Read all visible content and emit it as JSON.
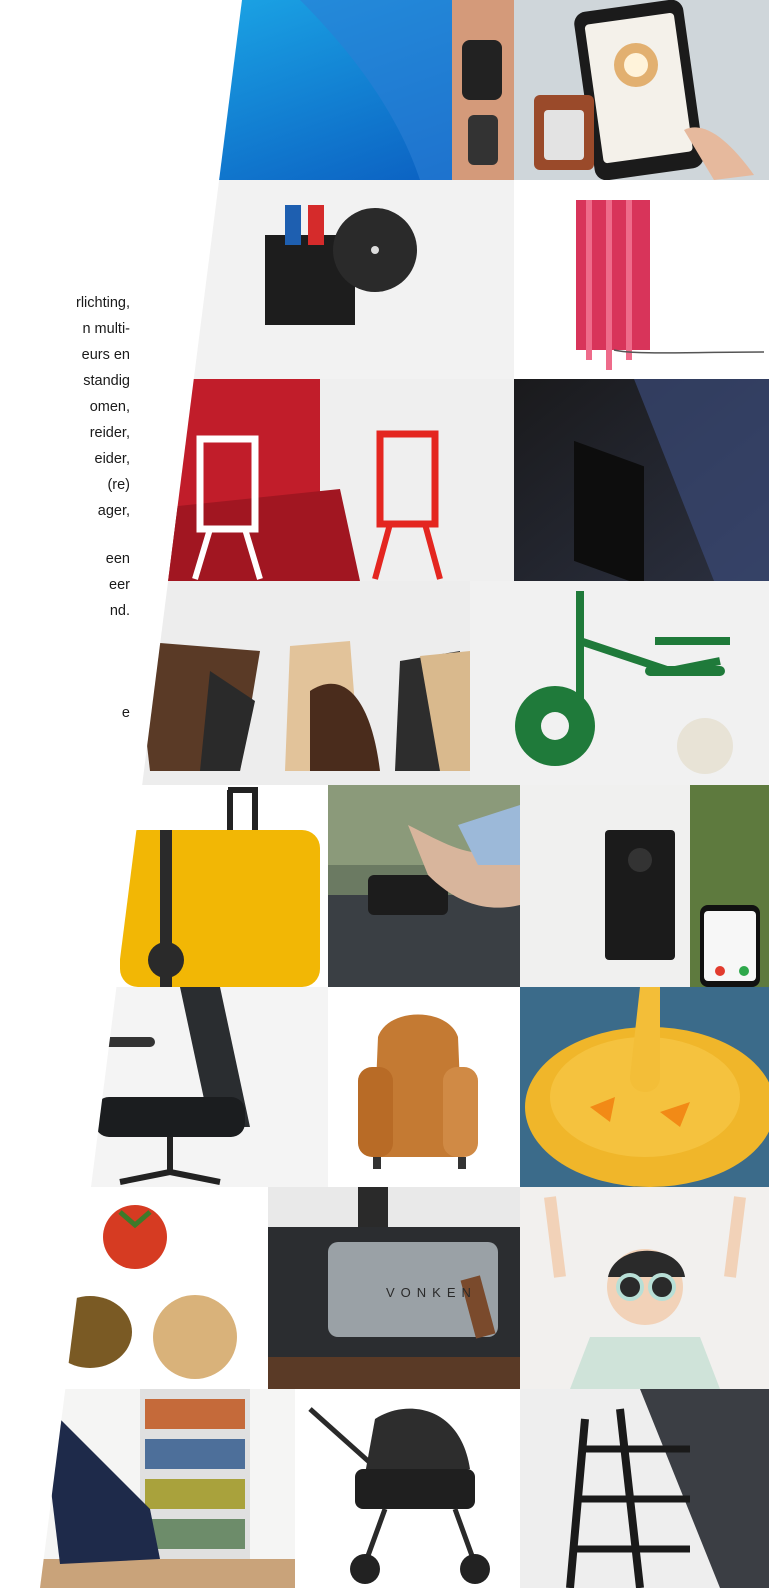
{
  "intro_text": {
    "paragraph1": [
      "rlichting,",
      "n multi-",
      "eurs en",
      "standig",
      "omen,",
      "reider,",
      "eider,",
      "(re)",
      "ager,"
    ],
    "paragraph2": [
      "een",
      "eer",
      "nd."
    ],
    "paragraph3": [
      "e"
    ]
  },
  "tiles": [
    {
      "name": "tile-exoskeleton"
    },
    {
      "name": "tile-tablet-device"
    },
    {
      "name": "tile-marker-holder"
    },
    {
      "name": "tile-red-lamp"
    },
    {
      "name": "tile-folding-chairs"
    },
    {
      "name": "tile-display-screen"
    },
    {
      "name": "tile-wooden-stools"
    },
    {
      "name": "tile-green-tricycle"
    },
    {
      "name": "tile-yellow-suitcase"
    },
    {
      "name": "tile-roof-rack-clamp"
    },
    {
      "name": "tile-video-doorbell"
    },
    {
      "name": "tile-office-chair"
    },
    {
      "name": "tile-leather-armchair"
    },
    {
      "name": "tile-yellow-bowl"
    },
    {
      "name": "tile-biomaterials"
    },
    {
      "name": "tile-vonken-stove"
    },
    {
      "name": "tile-kids-sunglasses"
    },
    {
      "name": "tile-lounge-chair"
    },
    {
      "name": "tile-stroller"
    },
    {
      "name": "tile-black-rack"
    }
  ],
  "product_labels": {
    "stove_brand": "VONKEN"
  },
  "colors": {
    "page_bg": "#ffffff",
    "text": "#1a1a1a",
    "accent_red": "#c8102e",
    "accent_yellow": "#f2b705",
    "accent_green": "#1f7a3a"
  }
}
